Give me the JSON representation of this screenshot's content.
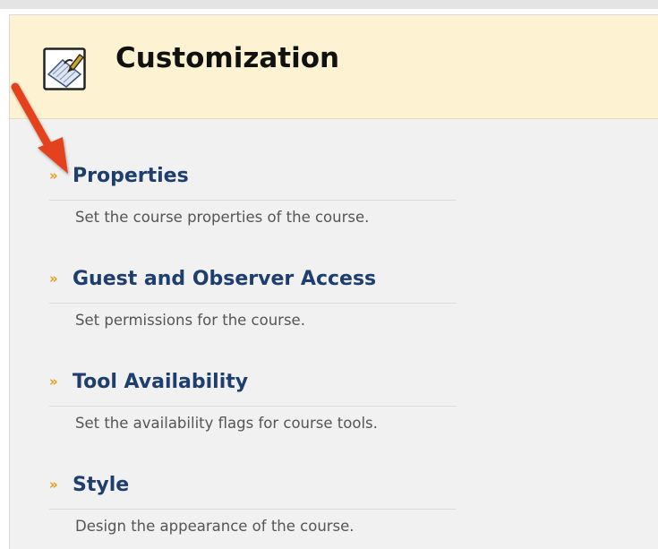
{
  "header": {
    "title": "Customization",
    "icon": "edit-pencil-icon"
  },
  "items": [
    {
      "title": "Properties",
      "description": "Set the course properties of the course."
    },
    {
      "title": "Guest and Observer Access",
      "description": "Set permissions for the course."
    },
    {
      "title": "Tool Availability",
      "description": "Set the availability flags for course tools."
    },
    {
      "title": "Style",
      "description": "Design the appearance of the course."
    }
  ],
  "bullet": "»",
  "colors": {
    "header_bg": "#fdf3d3",
    "panel_bg": "#f1f1f1",
    "link": "#1d3e6f",
    "bullet": "#e59a0f",
    "annotation_arrow": "#e4421c"
  }
}
